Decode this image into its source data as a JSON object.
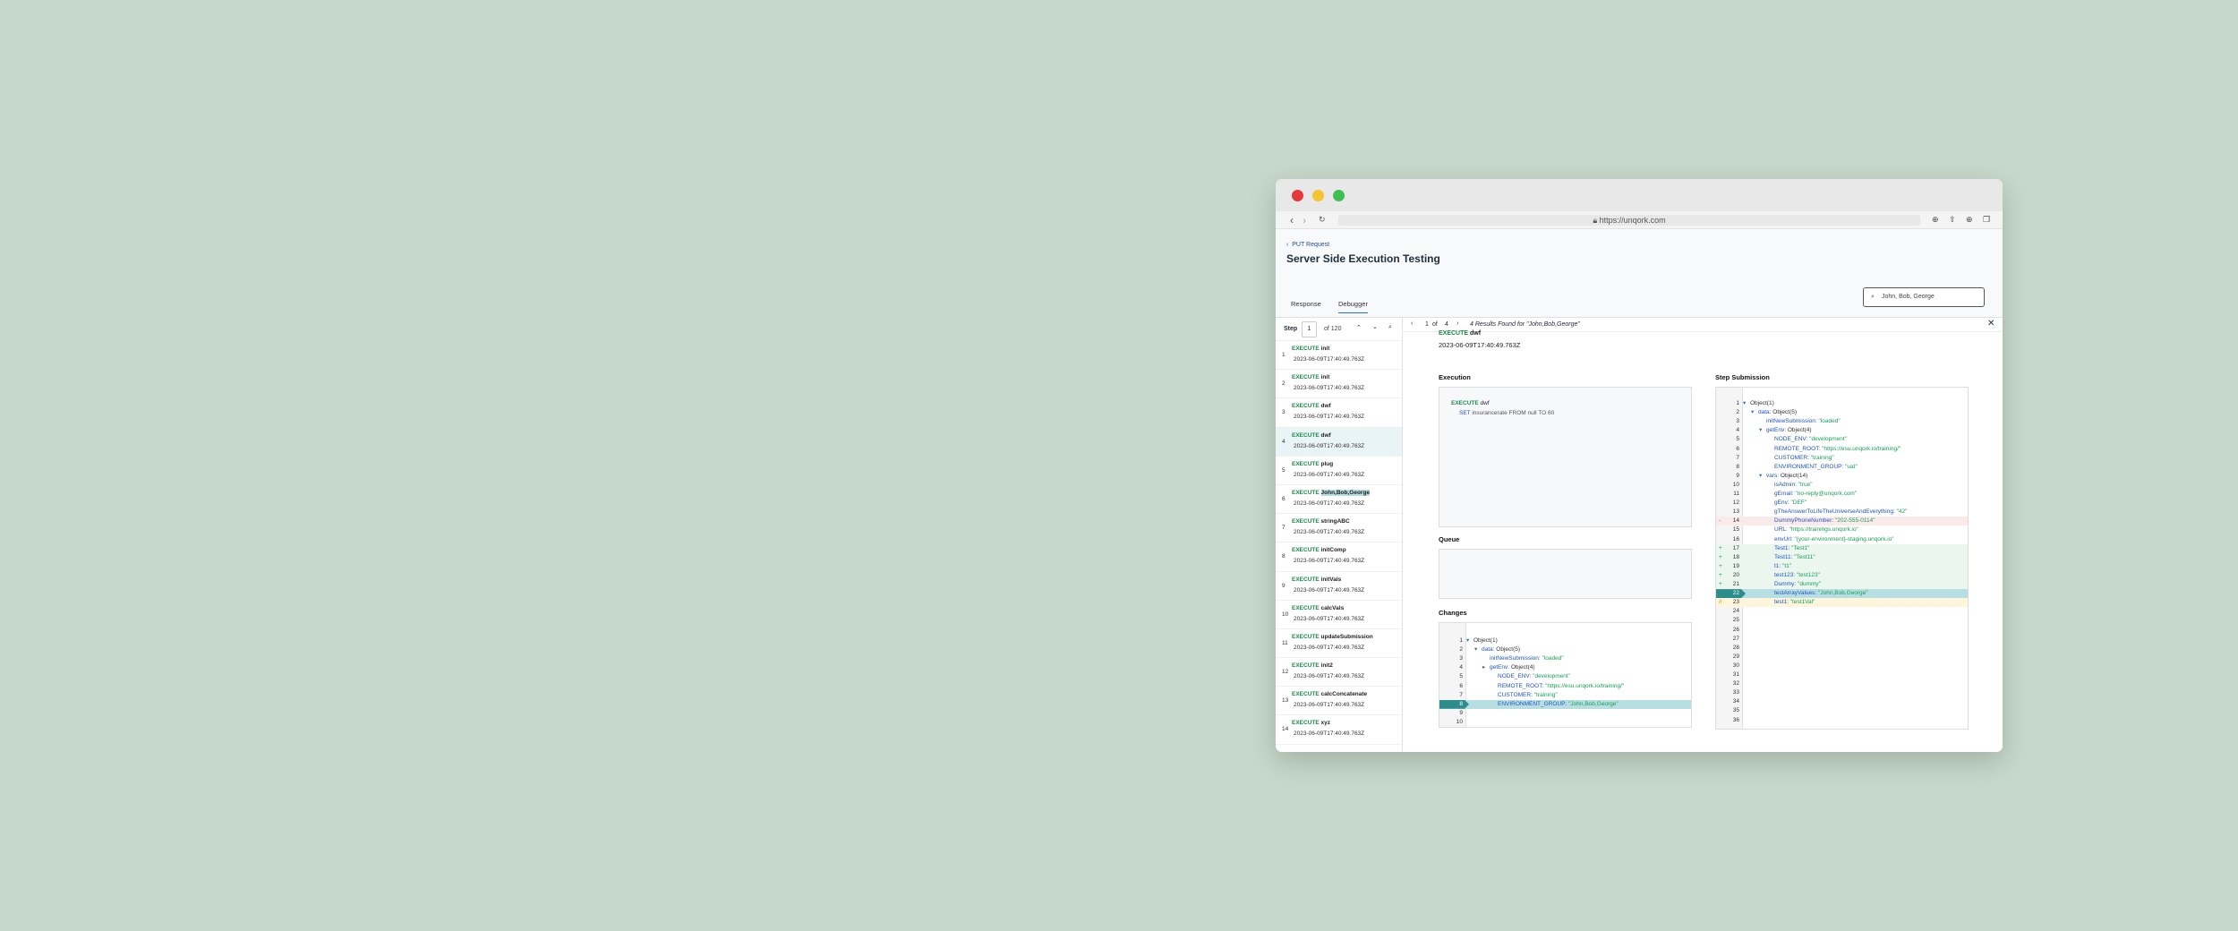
{
  "browser": {
    "url": "https://unqork.com"
  },
  "header": {
    "back_label": "PUT Request",
    "title": "Server Side Execution Testing"
  },
  "tabs": [
    {
      "label": "Response"
    },
    {
      "label": "Debugger"
    }
  ],
  "search": {
    "value": "John, Bob, George"
  },
  "stepbar": {
    "label": "Step",
    "value": "1",
    "total": "of 120"
  },
  "steps": [
    {
      "num": "1",
      "kw": "EXECUTE",
      "name": "init",
      "time": "2023-06-09T17:40:49.763Z"
    },
    {
      "num": "2",
      "kw": "EXECUTE",
      "name": "init",
      "time": "2023-06-09T17:40:49.763Z"
    },
    {
      "num": "3",
      "kw": "EXECUTE",
      "name": "dwf",
      "time": "2023-06-09T17:40:49.763Z"
    },
    {
      "num": "4",
      "kw": "EXECUTE",
      "name": "dwf",
      "time": "2023-06-09T17:40:49.763Z"
    },
    {
      "num": "5",
      "kw": "EXECUTE",
      "name": "plug",
      "time": "2023-06-09T17:40:49.763Z"
    },
    {
      "num": "6",
      "kw": "EXECUTE",
      "name": "John,Bob,George",
      "time": "2023-06-09T17:40:49.763Z"
    },
    {
      "num": "7",
      "kw": "EXECUTE",
      "name": "stringABC",
      "time": "2023-06-09T17:40:49.763Z"
    },
    {
      "num": "8",
      "kw": "EXECUTE",
      "name": "initComp",
      "time": "2023-06-09T17:40:49.763Z"
    },
    {
      "num": "9",
      "kw": "EXECUTE",
      "name": "initVals",
      "time": "2023-06-09T17:40:49.763Z"
    },
    {
      "num": "10",
      "kw": "EXECUTE",
      "name": "calcVals",
      "time": "2023-06-09T17:40:49.763Z"
    },
    {
      "num": "11",
      "kw": "EXECUTE",
      "name": "updateSubmission",
      "time": "2023-06-09T17:40:49.763Z"
    },
    {
      "num": "12",
      "kw": "EXECUTE",
      "name": "init2",
      "time": "2023-06-09T17:40:49.763Z"
    },
    {
      "num": "13",
      "kw": "EXECUTE",
      "name": "calcConcatenate",
      "time": "2023-06-09T17:40:49.763Z"
    },
    {
      "num": "14",
      "kw": "EXECUTE",
      "name": "xyz",
      "time": "2023-06-09T17:40:49.763Z"
    }
  ],
  "results": {
    "current": "1",
    "of": "of",
    "total": "4",
    "text": "4 Results Found for \"John,Bob,George\""
  },
  "detail": {
    "exec_heading_kw": "EXECUTE",
    "exec_heading_name": "dwf",
    "timestamp": "2023-06-09T17:40:49.763Z"
  },
  "execution": {
    "title": "Execution",
    "kw": "EXECUTE",
    "name": "dwf",
    "set_kw": "SET",
    "set_text": "insurancerate FROM null TO 60"
  },
  "queue": {
    "title": "Queue"
  },
  "changes": {
    "title": "Changes",
    "lines": [
      {
        "n": "1",
        "indent": 0,
        "arrow": "▾",
        "key": "Object(1)",
        "val": ""
      },
      {
        "n": "2",
        "indent": 1,
        "arrow": "▾",
        "key": "data:",
        "val": "Object(5)",
        "vt": "o"
      },
      {
        "n": "3",
        "indent": 2,
        "arrow": "",
        "key": "initNewSubmission:",
        "val": "\"loaded\""
      },
      {
        "n": "4",
        "indent": 2,
        "arrow": "▸",
        "key": "getEnv:",
        "val": "Object(4)",
        "vt": "o"
      },
      {
        "n": "5",
        "indent": 3,
        "arrow": "",
        "key": "NODE_ENV:",
        "val": "\"development\""
      },
      {
        "n": "6",
        "indent": 3,
        "arrow": "",
        "key": "REMOTE_ROOT:",
        "val": "\"https://esu.unqork.io/training/\""
      },
      {
        "n": "7",
        "indent": 3,
        "arrow": "",
        "key": "CUSTOMER:",
        "val": "\"training\""
      },
      {
        "n": "8",
        "indent": 3,
        "arrow": "",
        "key": "ENVIRONMENT_GROUP:",
        "val": "\"John,Bob,George\"",
        "active": true
      },
      {
        "n": "9",
        "indent": 0,
        "arrow": "",
        "key": "",
        "val": ""
      },
      {
        "n": "10",
        "indent": 0,
        "arrow": "",
        "key": "",
        "val": ""
      }
    ]
  },
  "submission": {
    "title": "Step Submission",
    "lines": [
      {
        "n": "1",
        "indent": 0,
        "arrow": "▾",
        "key": "Object(1)",
        "val": ""
      },
      {
        "n": "2",
        "indent": 1,
        "arrow": "▾",
        "key": "data:",
        "val": "Object(5)",
        "vt": "o"
      },
      {
        "n": "3",
        "indent": 2,
        "arrow": "",
        "key": "initNewSubmission:",
        "val": "\"loaded\""
      },
      {
        "n": "4",
        "indent": 2,
        "arrow": "▾",
        "key": "getEnv:",
        "val": "Object(4)",
        "vt": "o"
      },
      {
        "n": "5",
        "indent": 3,
        "arrow": "",
        "key": "NODE_ENV:",
        "val": "\"development\""
      },
      {
        "n": "6",
        "indent": 3,
        "arrow": "",
        "key": "REMOTE_ROOT:",
        "val": "\"https://esu.unqork.io/training/\""
      },
      {
        "n": "7",
        "indent": 3,
        "arrow": "",
        "key": "CUSTOMER:",
        "val": "\"training\""
      },
      {
        "n": "8",
        "indent": 3,
        "arrow": "",
        "key": "ENVIRONMENT_GROUP:",
        "val": "\"uat\""
      },
      {
        "n": "9",
        "indent": 2,
        "arrow": "▾",
        "key": "vars:",
        "val": "Object(14)",
        "vt": "o"
      },
      {
        "n": "10",
        "indent": 3,
        "arrow": "",
        "key": "isAdmin:",
        "val": "\"true\""
      },
      {
        "n": "11",
        "indent": 3,
        "arrow": "",
        "key": "gEmail:",
        "val": "\"no-reply@unqork.com\""
      },
      {
        "n": "12",
        "indent": 3,
        "arrow": "",
        "key": "gEnv:",
        "val": "\"DEF\""
      },
      {
        "n": "13",
        "indent": 3,
        "arrow": "",
        "key": "gTheAnswerToLifeTheUniverseAndEverything:",
        "val": "\"42\""
      },
      {
        "n": "14",
        "indent": 3,
        "arrow": "",
        "key": "DummyPhoneNumber:",
        "val": "\"202-555-0114\"",
        "mark": "-",
        "state": "del"
      },
      {
        "n": "15",
        "indent": 3,
        "arrow": "",
        "key": "URL:",
        "val": "\"https://trainings.unqork.io\""
      },
      {
        "n": "16",
        "indent": 3,
        "arrow": "",
        "key": "envUrl:",
        "val": "\"{your-environment}-staging.unqork.io\""
      },
      {
        "n": "17",
        "indent": 3,
        "arrow": "",
        "key": "Test1:",
        "val": "\"Test1\"",
        "mark": "+",
        "state": "add"
      },
      {
        "n": "18",
        "indent": 3,
        "arrow": "",
        "key": "Test11:",
        "val": "\"Test11\"",
        "mark": "+",
        "state": "add"
      },
      {
        "n": "19",
        "indent": 3,
        "arrow": "",
        "key": "t1:",
        "val": "\"t1\"",
        "mark": "+",
        "state": "add"
      },
      {
        "n": "20",
        "indent": 3,
        "arrow": "",
        "key": "test123:",
        "val": "\"test123\"",
        "mark": "+",
        "state": "add"
      },
      {
        "n": "21",
        "indent": 3,
        "arrow": "",
        "key": "Dummy:",
        "val": "\"dummy\"",
        "mark": "+",
        "state": "add"
      },
      {
        "n": "22",
        "indent": 3,
        "arrow": "",
        "key": "testArrayValues:",
        "val": "\"John,Bob,George\"",
        "state": "active"
      },
      {
        "n": "23",
        "indent": 3,
        "arrow": "",
        "key": "test1:",
        "val": "\"test1Val\"",
        "mark": "//",
        "state": "mod"
      },
      {
        "n": "24"
      },
      {
        "n": "25"
      },
      {
        "n": "26"
      },
      {
        "n": "27"
      },
      {
        "n": "28"
      },
      {
        "n": "29"
      },
      {
        "n": "30"
      },
      {
        "n": "31"
      },
      {
        "n": "32"
      },
      {
        "n": "33"
      },
      {
        "n": "34"
      },
      {
        "n": "35"
      },
      {
        "n": "36"
      }
    ]
  },
  "colors": {
    "background": "#c5d8c9",
    "keyword": "#1a8a4a",
    "key": "#1f55c2",
    "value": "#18a058",
    "active_row": "#b7dfe3",
    "active_gutter": "#2d8c8c",
    "added": "#eaf6ee",
    "deleted": "#fbeaea",
    "modified": "#fdf6dc"
  },
  "icons": [
    "close-dot",
    "minimize-dot",
    "zoom-dot",
    "back-arrow-icon",
    "forward-arrow-icon",
    "reload-icon",
    "lock-icon",
    "download-icon",
    "share-icon",
    "add-tab-icon",
    "tabs-icon",
    "chevron-left-icon",
    "search-icon",
    "chevron-up-icon",
    "chevron-down-icon",
    "close-icon"
  ]
}
